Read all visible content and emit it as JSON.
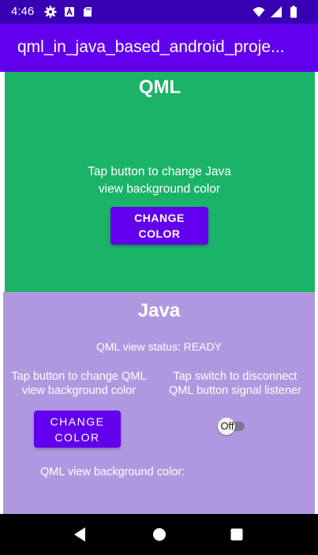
{
  "status_bar": {
    "time": "4:46",
    "icons": [
      "gear-icon",
      "font-a-icon",
      "sd-card-icon",
      "wifi-icon",
      "signal-icon",
      "battery-icon"
    ]
  },
  "app_bar": {
    "title": "qml_in_java_based_android_proje..."
  },
  "qml_section": {
    "title": "QML",
    "description_line1": "Tap button to change Java",
    "description_line2": "view background color",
    "button_line1": "CHANGE",
    "button_line2": "COLOR",
    "background_color": "#1bb367"
  },
  "java_section": {
    "title": "Java",
    "status_text": "QML view status: READY",
    "left_desc_line1": "Tap button to change QML",
    "left_desc_line2": "view background color",
    "right_desc_line1": "Tap switch to disconnect",
    "right_desc_line2": "QML button signal listener",
    "button_line1": "CHANGE",
    "button_line2": "COLOR",
    "switch_label": "Off",
    "switch_on": false,
    "bg_color_label": "QML view background color:",
    "background_color": "#b098e0"
  },
  "nav_bar": {
    "icons": [
      "back-icon",
      "home-icon",
      "recents-icon"
    ]
  },
  "colors": {
    "status_bar": "#3700b3",
    "app_bar": "#6200ee",
    "button": "#6200ee"
  }
}
